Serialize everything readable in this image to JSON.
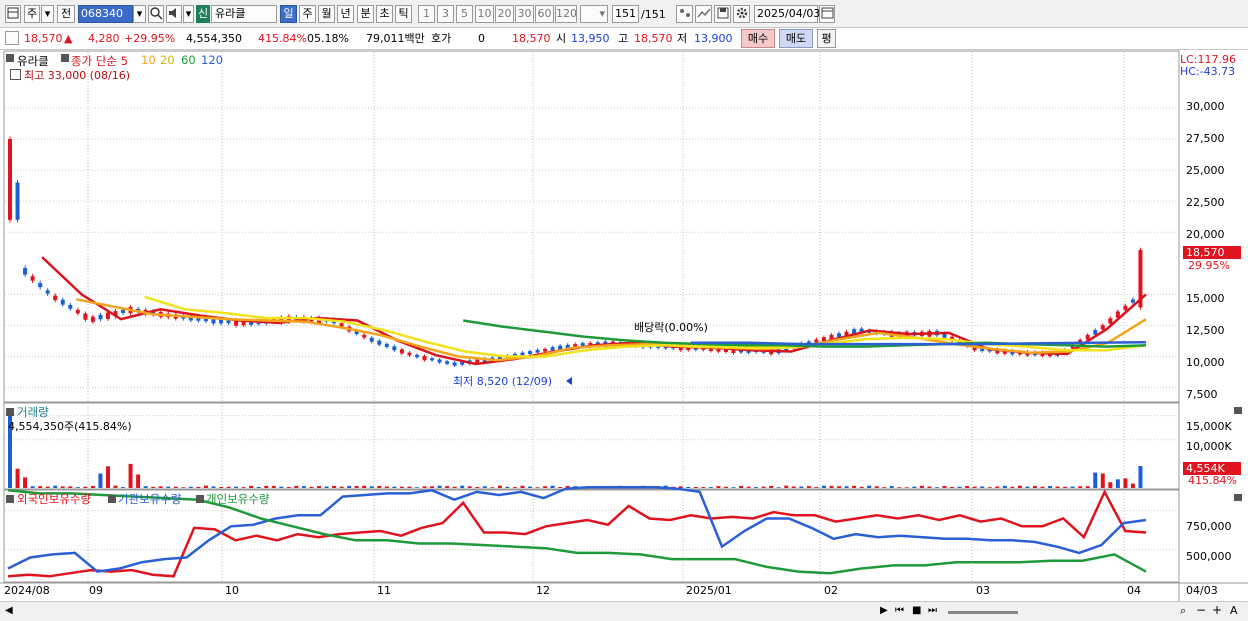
{
  "toolbar": {
    "period_type": "주",
    "period_type2": "전",
    "stock_code": "068340",
    "market_badge": "신",
    "stock_name": "유라클",
    "tf_day": "일",
    "tf_week": "주",
    "tf_month": "월",
    "tf_year": "년",
    "tf_min": "분",
    "tf_sec": "초",
    "tf_tick": "틱",
    "intervals": [
      "1",
      "3",
      "5",
      "10",
      "20",
      "30",
      "60",
      "120"
    ],
    "count": "151",
    "total": "/151",
    "date": "2025/04/03"
  },
  "info": {
    "price": "18,570",
    "change": "4,280",
    "change_pct": "+29.95%",
    "volume": "4,554,350",
    "volume_pct": "415.84%",
    "turnover_pct": "05.18%",
    "amount": "79,011백만",
    "hoga_label": "호가",
    "hoga_value": "0",
    "open_price": "18,570",
    "open_label": "시",
    "open_value": "13,950",
    "high_label": "고",
    "high_value": "18,570",
    "low_label": "저",
    "low_value": "13,900",
    "buy_label": "매수",
    "sell_label": "매도",
    "avg_label": "평"
  },
  "price_panel": {
    "stock_label": "유라클",
    "ma_label": "종가 단순 5",
    "ma_periods": [
      "10",
      "20",
      "60",
      "120"
    ],
    "high_annot": "최고 33,000 (08/16)",
    "low_annot": "최저 8,520 (12/09)",
    "dividend_annot": "배당락(0.00%)",
    "lc": "LC:117.96",
    "hc": "HC:-43.73",
    "y_ticks": [
      "30,000",
      "27,500",
      "25,000",
      "22,500",
      "20,000",
      "15,000",
      "12,500",
      "10,000",
      "7,500"
    ],
    "last_price": "18,570",
    "last_pct": "29.95%"
  },
  "volume_panel": {
    "title": "거래량",
    "value_annot": "4,554,350주(415.84%)",
    "y_ticks": [
      "15,000K",
      "10,000K"
    ],
    "last_vol": "4,554K",
    "last_pct": "415.84%"
  },
  "holding_panel": {
    "series_names": [
      "외국인보유수량",
      "기관보유수량",
      "개인보유수량"
    ],
    "y_ticks": [
      "750,000",
      "500,000"
    ]
  },
  "x_axis": {
    "labels": [
      "2024/08",
      "09",
      "10",
      "11",
      "12",
      "2025/01",
      "02",
      "03",
      "04",
      "04/03"
    ]
  },
  "colors": {
    "up": "#e0141e",
    "down": "#1a5fd6",
    "ma5": "#d9141e",
    "ma10": "#f5a31a",
    "ma20": "#f2e21a",
    "ma60": "#1f9a3a",
    "ma120": "#2a5fd6"
  },
  "chart_data": [
    {
      "type": "line",
      "title": "",
      "y_unit": "KRW",
      "ylim": [
        6500,
        34500
      ],
      "x_range": [
        "2024/08",
        "2025/04/03"
      ],
      "candles_summary": {
        "high": 33000,
        "high_date": "08/16",
        "low": 8520,
        "low_date": "12/09",
        "last_close": 18570,
        "last_open": 13950,
        "last_high": 18570,
        "last_low": 13900
      },
      "series": [
        {
          "name": "5",
          "values": [
            18000,
            15000,
            13000,
            13800,
            13300,
            12900,
            12700,
            13100,
            12900,
            11300,
            10100,
            9400,
            9800,
            10400,
            10900,
            11100,
            10800,
            10700,
            10500,
            10400,
            11300,
            12100,
            11800,
            11900,
            10600,
            10300,
            10200,
            12200,
            15000
          ]
        },
        {
          "name": "10",
          "values": [
            14600,
            14000,
            13400,
            13200,
            13000,
            12900,
            12800,
            12300,
            11700,
            10800,
            10000,
            9700,
            10000,
            10700,
            10900,
            11000,
            10800,
            10700,
            10600,
            10800,
            11400,
            11900,
            11500,
            11000,
            10600,
            10300,
            10400,
            11100,
            13000
          ]
        },
        {
          "name": "20",
          "values": [
            14800,
            13800,
            13500,
            13100,
            13100,
            12800,
            12100,
            11200,
            10400,
            10000,
            10000,
            10500,
            10800,
            10900,
            10800,
            10700,
            10700,
            11000,
            11400,
            11500,
            11400,
            11000,
            10800,
            10500,
            10500,
            10900
          ]
        },
        {
          "name": "60",
          "values": [
            12900,
            12400,
            12000,
            11600,
            11300,
            11100,
            11000,
            10900,
            10900,
            10800,
            10800,
            10900,
            11000,
            11100,
            11000,
            10900,
            10800,
            10900
          ]
        },
        {
          "name": "120",
          "values": [
            11100,
            11100,
            11000,
            11000,
            11000,
            11000,
            11050,
            11100,
            11150
          ]
        }
      ]
    },
    {
      "type": "bar",
      "title": "",
      "values_K": [
        15500,
        3000,
        1800,
        1000,
        800,
        600,
        500,
        500,
        700,
        5000,
        800,
        900,
        500,
        300,
        200,
        4554
      ],
      "ylim": [
        0,
        17000
      ]
    },
    {
      "type": "line",
      "title": "",
      "ylim": [
        300000,
        850000
      ],
      "series": [
        {
          "name": "외국인보유수량",
          "values": [
            330000,
            340000,
            330000,
            350000,
            370000,
            360000,
            370000,
            340000,
            330000,
            640000,
            630000,
            560000,
            590000,
            560000,
            600000,
            580000,
            600000,
            610000,
            620000,
            590000,
            640000,
            670000,
            800000,
            610000,
            610000,
            600000,
            650000,
            670000,
            690000,
            660000,
            780000,
            700000,
            690000,
            720000,
            700000,
            710000,
            700000,
            740000,
            720000,
            720000,
            680000,
            700000,
            720000,
            700000,
            720000,
            690000,
            720000,
            680000,
            700000,
            650000,
            650000,
            700000,
            580000,
            870000,
            620000,
            610000
          ]
        },
        {
          "name": "기관보유수량",
          "values": [
            380000,
            450000,
            470000,
            480000,
            360000,
            380000,
            420000,
            440000,
            450000,
            560000,
            650000,
            660000,
            700000,
            720000,
            720000,
            840000,
            850000,
            860000,
            860000,
            880000,
            820000,
            870000,
            850000,
            870000,
            830000,
            890000,
            900000,
            900000,
            900000,
            900000,
            890000,
            870000,
            520000,
            620000,
            700000,
            700000,
            640000,
            570000,
            600000,
            580000,
            590000,
            580000,
            570000,
            570000,
            560000,
            560000,
            550000,
            520000,
            480000,
            530000,
            670000,
            690000
          ]
        },
        {
          "name": "개인보유수량",
          "values": [
            880000,
            860000,
            860000,
            850000,
            840000,
            830000,
            820000,
            770000,
            700000,
            650000,
            600000,
            560000,
            560000,
            540000,
            540000,
            530000,
            520000,
            510000,
            480000,
            480000,
            470000,
            440000,
            440000,
            440000,
            390000,
            360000,
            350000,
            380000,
            400000,
            400000,
            420000,
            420000,
            420000,
            430000,
            430000,
            470000,
            360000
          ]
        }
      ]
    }
  ]
}
